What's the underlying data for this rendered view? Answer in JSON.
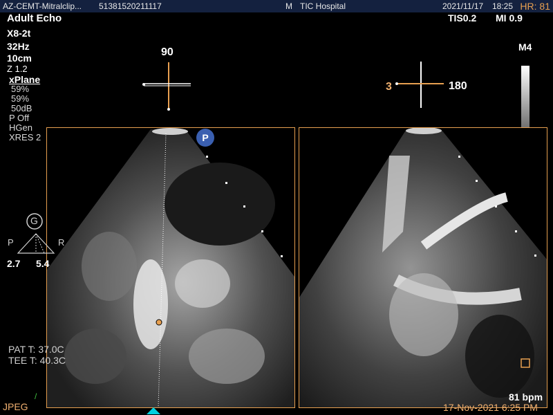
{
  "header": {
    "study": "AZ-CEMT-Mitralclip...",
    "id": "51381520211117",
    "marker": "M",
    "hospital": "TIC Hospital",
    "date": "2021/11/17",
    "time": "18:25",
    "hr": "HR: 81"
  },
  "preset": "Adult Echo",
  "tis": "TIS0.2",
  "mi": "MI 0.9",
  "params": {
    "probe": "X8-2t",
    "rate": "32Hz",
    "depth": "10cm",
    "zoom": "Z 1.2",
    "mode": "xPlane",
    "gain1": "59%",
    "gain2": "59%",
    "dynamic_range": "50dB",
    "power": "P Off",
    "freq": "HGen",
    "xres": "XRES 2"
  },
  "left_plane": {
    "angle": "90",
    "badge": "P"
  },
  "right_plane": {
    "angle_a": "3",
    "angle_b": "180"
  },
  "map": "M4",
  "orientation": {
    "logo": "G",
    "left": "P",
    "right": "R",
    "val_left": "2.7",
    "val_right": "5.4"
  },
  "temps": {
    "pat": "PAT T: 37.0C",
    "tee": "TEE T: 40.3C"
  },
  "footer": {
    "format": "JPEG",
    "bpm": "81 bpm",
    "timestamp": "17-Nov-2021 6:25 PM"
  },
  "colors": {
    "accent": "#e8a050",
    "header_bg": "#14213f",
    "badge": "#3a5fb0",
    "cyan": "#00d0e0"
  }
}
